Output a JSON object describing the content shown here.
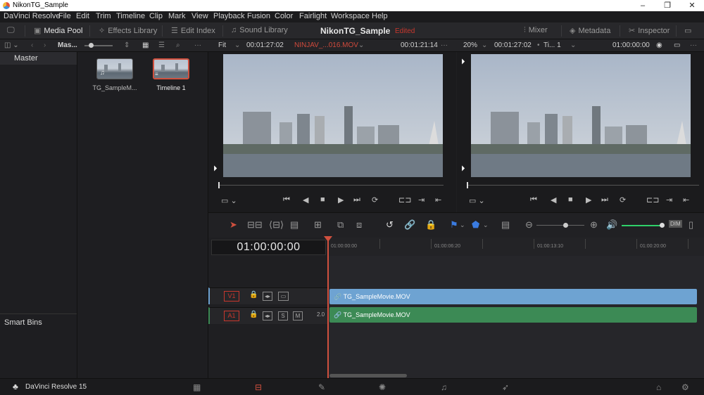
{
  "window": {
    "title": "NikonTG_Sample",
    "min": "–",
    "max": "❐",
    "close": "✕"
  },
  "menu": [
    "DaVinci Resolve",
    "File",
    "Edit",
    "Trim",
    "Timeline",
    "Clip",
    "Mark",
    "View",
    "Playback",
    "Fusion",
    "Color",
    "Fairlight",
    "Workspace",
    "Help"
  ],
  "toolbar": {
    "media_pool": "Media Pool",
    "effects_library": "Effects Library",
    "edit_index": "Edit Index",
    "sound_library": "Sound Library",
    "project_name": "NikonTG_Sample",
    "edited": "Edited",
    "mixer": "Mixer",
    "metadata": "Metadata",
    "inspector": "Inspector"
  },
  "subbar": {
    "bin": "Mas...",
    "fit": "Fit",
    "src_tc": "00:01:27:02",
    "src_clip": "NINJAV_...016.MOV",
    "src_dur": "00:01:21:14",
    "zoom": "20%",
    "tl_tc": "00:01:27:02",
    "tl_name": "Ti... 1",
    "tl_tc2": "01:00:00:00"
  },
  "sidebar": {
    "master": "Master",
    "smart_bins": "Smart Bins"
  },
  "pool": {
    "items": [
      {
        "label": "TG_SampleM..."
      },
      {
        "label": "Timeline 1"
      }
    ]
  },
  "timeline": {
    "timecode": "01:00:00:00",
    "ruler": [
      "01:00:00:00",
      "01:00:06:20",
      "01:00:13:10",
      "01:00:20:00"
    ],
    "tracks": [
      {
        "name": "V1",
        "clip": "TG_SampleMovie.MOV",
        "color": "#6ea3d2"
      },
      {
        "name": "A1",
        "clip": "TG_SampleMovie.MOV",
        "level": "2.0",
        "color": "#3c8a55"
      }
    ],
    "solo": "S",
    "mute": "M",
    "dim": "DIM"
  },
  "footer": {
    "app": "DaVinci Resolve 15"
  }
}
